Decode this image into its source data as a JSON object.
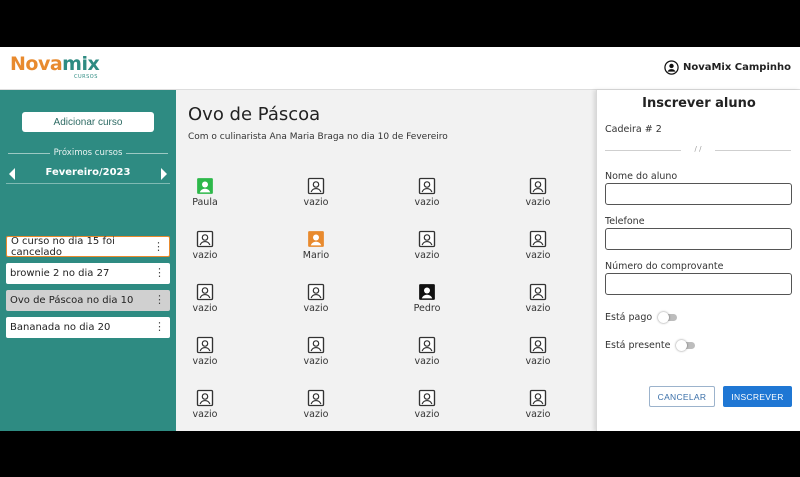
{
  "header": {
    "logo_nova": "Nova",
    "logo_mix": "mix",
    "logo_sub": "CURSOS",
    "user_name": "NovaMix Campinho"
  },
  "sidebar": {
    "add_course_label": "Adicionar curso",
    "next_courses_label": "Próximos cursos",
    "month_label": "Fevereiro/2023",
    "courses": [
      {
        "label": "O curso no dia 15 foi cancelado",
        "state": "focused"
      },
      {
        "label": "brownie 2 no dia 27",
        "state": "normal"
      },
      {
        "label": "Ovo de Páscoa no dia 10",
        "state": "selected"
      },
      {
        "label": "Bananada no dia 20",
        "state": "normal"
      }
    ]
  },
  "main": {
    "title": "Ovo de Páscoa",
    "subtitle": "Com o culinarista Ana Maria Braga no dia 10 de Fevereiro",
    "seats": [
      {
        "label": "Paula",
        "status": "green"
      },
      {
        "label": "vazio",
        "status": "empty"
      },
      {
        "label": "vazio",
        "status": "empty"
      },
      {
        "label": "vazio",
        "status": "empty"
      },
      {
        "label": "vazio",
        "status": "empty"
      },
      {
        "label": "Mario",
        "status": "orange"
      },
      {
        "label": "vazio",
        "status": "empty"
      },
      {
        "label": "vazio",
        "status": "empty"
      },
      {
        "label": "vazio",
        "status": "empty"
      },
      {
        "label": "vazio",
        "status": "empty"
      },
      {
        "label": "Pedro",
        "status": "black"
      },
      {
        "label": "vazio",
        "status": "empty"
      },
      {
        "label": "vazio",
        "status": "empty"
      },
      {
        "label": "vazio",
        "status": "empty"
      },
      {
        "label": "vazio",
        "status": "empty"
      },
      {
        "label": "vazio",
        "status": "empty"
      },
      {
        "label": "vazio",
        "status": "empty"
      },
      {
        "label": "vazio",
        "status": "empty"
      },
      {
        "label": "vazio",
        "status": "empty"
      },
      {
        "label": "vazio",
        "status": "empty"
      }
    ]
  },
  "panel": {
    "title": "Inscrever aluno",
    "chair_label": "Cadeira # 2",
    "separator": "/ /",
    "name_label": "Nome do aluno",
    "name_value": "",
    "phone_label": "Telefone",
    "phone_value": "",
    "receipt_label": "Número do comprovante",
    "receipt_value": "",
    "paid_label": "Está pago",
    "present_label": "Está presente",
    "cancel_label": "CANCELAR",
    "submit_label": "INSCREVER"
  },
  "colors": {
    "brand_teal": "#2e8b82",
    "brand_orange": "#e88a2e",
    "seat_green": "#2db84a",
    "seat_orange": "#e88a2e",
    "seat_black": "#111111",
    "primary_button": "#1f77d4"
  },
  "icons": {
    "user": "account-circle-icon",
    "seat": "account-box-icon",
    "course_menu": "more-vertical-icon",
    "prev": "chevron-left-icon",
    "next": "chevron-right-icon"
  }
}
